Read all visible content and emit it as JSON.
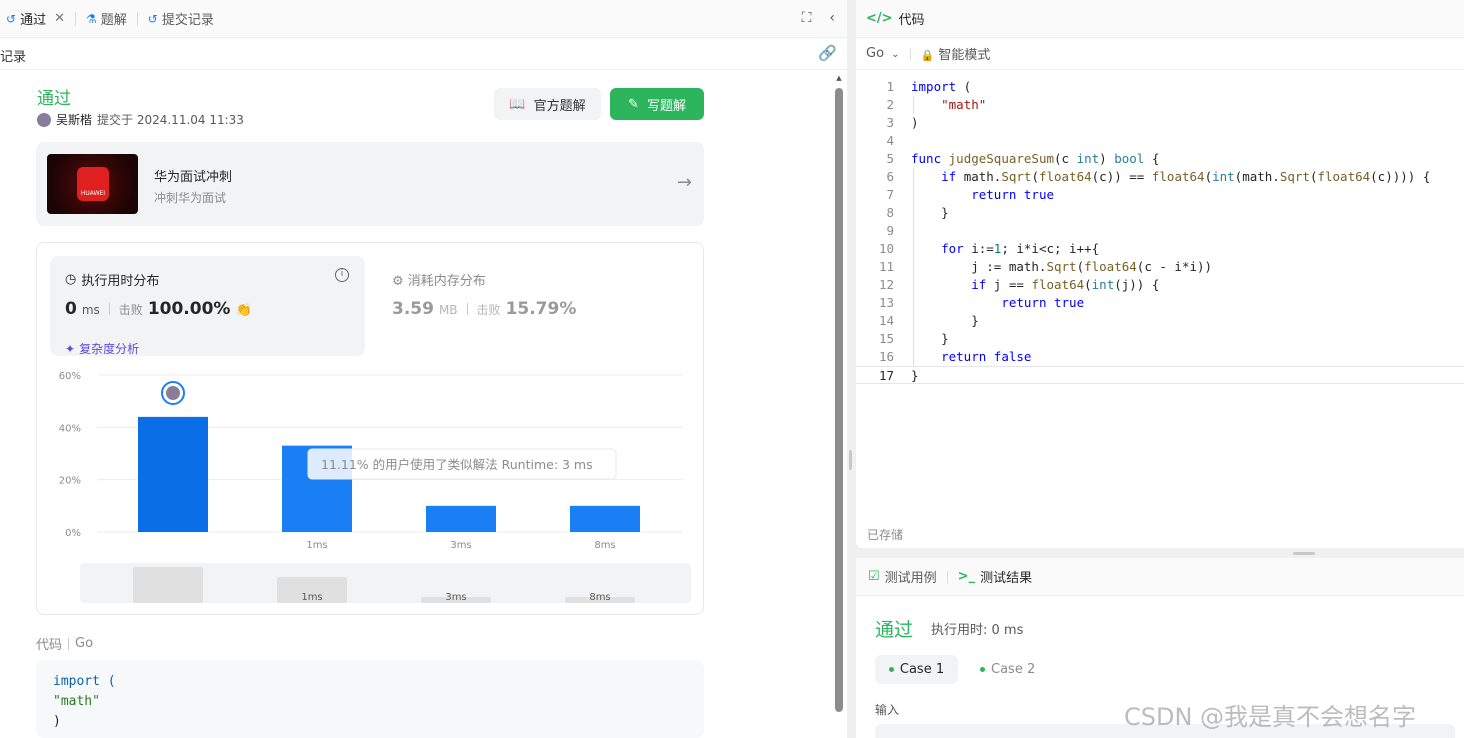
{
  "left_tabs": [
    {
      "label": "通过",
      "icon": "history-icon",
      "active": true
    },
    {
      "label": "题解",
      "icon": "flask-icon",
      "active": false
    },
    {
      "label": "提交记录",
      "icon": "history-icon",
      "active": false
    }
  ],
  "subheader": {
    "title": "记录"
  },
  "submission": {
    "status": "通过",
    "user": "吴斯楷",
    "submitted_text": "提交于 2024.11.04 11:33"
  },
  "buttons": {
    "official": "官方题解",
    "write": "写题解"
  },
  "promo": {
    "title": "华为面试冲刺",
    "subtitle": "冲刺华为面试",
    "logo_text": "HUAWEI"
  },
  "runtime": {
    "header": "执行用时分布",
    "value": "0",
    "unit": "ms",
    "beat_label": "击败",
    "beat_value": "100.00%",
    "complexity": "复杂度分析"
  },
  "memory": {
    "header": "消耗内存分布",
    "value": "3.59",
    "unit": "MB",
    "beat_label": "击败",
    "beat_value": "15.79%"
  },
  "chart_data": {
    "type": "bar",
    "categories": [
      "",
      "1ms",
      "3ms",
      "8ms"
    ],
    "values": [
      44,
      33,
      10,
      10
    ],
    "y_ticks": [
      "60%",
      "40%",
      "20%",
      "0%"
    ],
    "ylim": [
      0,
      60
    ],
    "grid": true,
    "tooltip": "11.11% 的用户使用了类似解法 Runtime: 3 ms",
    "highlight_index": 0,
    "overview_labels": [
      "",
      "1ms",
      "3ms",
      "8ms"
    ],
    "overview_values": [
      36,
      26,
      6,
      6
    ],
    "colors": {
      "highlight": "#0a6fe6",
      "bar": "#1a7ff5",
      "overview": "#e0e0e0"
    }
  },
  "code_label": {
    "title": "代码",
    "lang": "Go"
  },
  "code_preview": [
    "import (",
    "    \"math\"",
    ")"
  ],
  "code_panel": {
    "title": "代码",
    "language": "Go",
    "mode": "智能模式",
    "saved": "已存储",
    "lines": [
      "import (",
      "    \"math\"",
      ")",
      "",
      "func judgeSquareSum(c int) bool {",
      "    if math.Sqrt(float64(c)) == float64(int(math.Sqrt(float64(c)))) {",
      "        return true",
      "    }",
      "",
      "    for i:=1; i*i<c; i++{",
      "        j := math.Sqrt(float64(c - i*i))",
      "        if j == float64(int(j)) {",
      "            return true",
      "        }",
      "    }",
      "    return false",
      "}"
    ],
    "line_numbers": [
      "1",
      "2",
      "3",
      "4",
      "5",
      "6",
      "7",
      "8",
      "9",
      "10",
      "11",
      "12",
      "13",
      "14",
      "15",
      "16",
      "17"
    ]
  },
  "result_panel": {
    "tab_cases": "测试用例",
    "tab_result": "测试结果",
    "status": "通过",
    "runtime": "执行用时: 0 ms",
    "case1": "Case 1",
    "case2": "Case 2",
    "input_label": "输入"
  },
  "watermark": "CSDN @我是真不会想名字",
  "colors": {
    "accent": "#2db55d",
    "link": "#5f4bd6",
    "bar": "#1a7ff5"
  }
}
